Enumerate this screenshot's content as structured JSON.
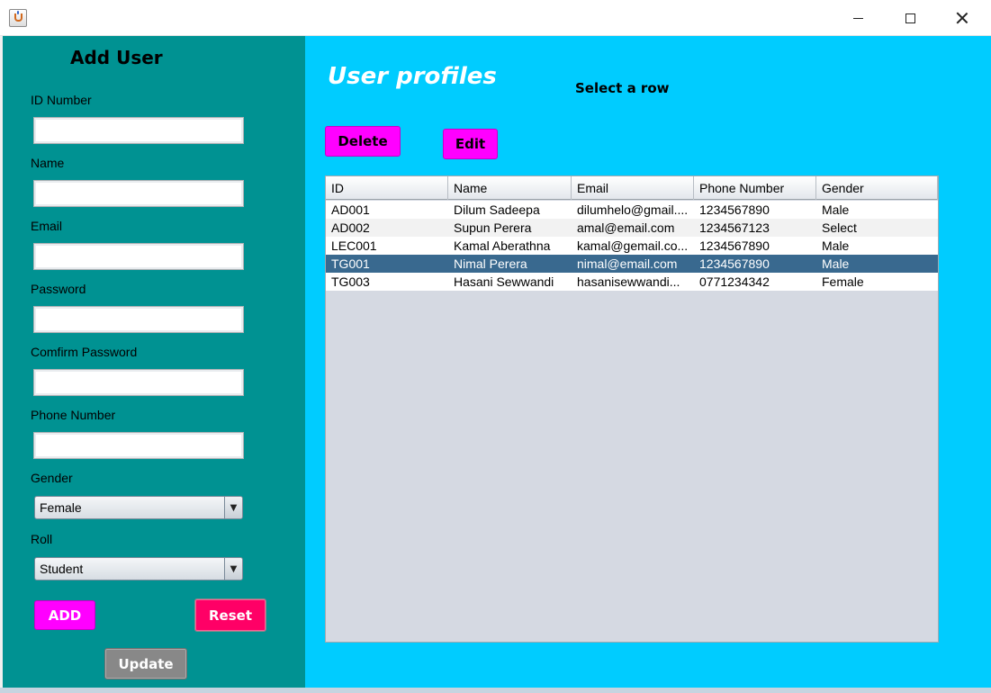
{
  "window": {
    "app_icon": "java-cup-icon",
    "title": ""
  },
  "left_panel": {
    "title": "Add User",
    "fields": {
      "id_number": {
        "label": "ID Number",
        "value": ""
      },
      "name": {
        "label": "Name",
        "value": ""
      },
      "email": {
        "label": "Email",
        "value": ""
      },
      "password": {
        "label": "Password",
        "value": ""
      },
      "confirm_password": {
        "label": "Comfirm Password",
        "value": ""
      },
      "phone_number": {
        "label": "Phone Number",
        "value": ""
      }
    },
    "gender": {
      "label": "Gender",
      "selected": "Female"
    },
    "roll": {
      "label": "Roll",
      "selected": "Student"
    },
    "buttons": {
      "add": "ADD",
      "reset": "Reset",
      "update": "Update"
    },
    "colors": {
      "background": "#009292"
    }
  },
  "right_panel": {
    "title": "User profiles",
    "hint": "Select a row",
    "buttons": {
      "delete": "Delete",
      "edit": "Edit"
    },
    "colors": {
      "background": "#00ccff",
      "selected_row": "#39698f",
      "button": "#ff00ff"
    },
    "table": {
      "columns": [
        "ID",
        "Name",
        "Email",
        "Phone Number",
        "Gender"
      ],
      "rows": [
        [
          "AD001",
          "Dilum Sadeepa",
          "dilumhelo@gmail....",
          "1234567890",
          "Male"
        ],
        [
          "AD002",
          "Supun Perera",
          "amal@email.com",
          "1234567123",
          "Select"
        ],
        [
          "LEC001",
          "Kamal Aberathna",
          "kamal@gemail.co...",
          "1234567890",
          "Male"
        ],
        [
          "TG001",
          "Nimal Perera",
          "nimal@email.com",
          "1234567890",
          "Male"
        ],
        [
          "TG003",
          "Hasani Sewwandi",
          "hasanisewwandi...",
          "0771234342",
          "Female"
        ]
      ],
      "selected_row": 3
    }
  }
}
